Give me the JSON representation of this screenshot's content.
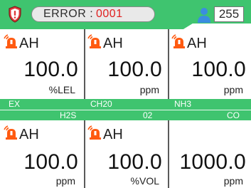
{
  "header": {
    "error_label": "ERROR :",
    "error_code": "0001",
    "user_count": "255",
    "colors": {
      "bar": "#3fc46f",
      "error_code": "#e02020"
    }
  },
  "cells": [
    {
      "status": "AH",
      "value": "100.0",
      "unit": "%LEL"
    },
    {
      "status": "AH",
      "value": "100.0",
      "unit": "ppm"
    },
    {
      "status": "AH",
      "value": "100.0",
      "unit": "ppm"
    },
    {
      "status": "AH",
      "value": "100.0",
      "unit": "ppm"
    },
    {
      "status": "AH",
      "value": "100.0",
      "unit": "%VOL"
    },
    {
      "status": "",
      "value": "1000.0",
      "unit": "ppm"
    }
  ],
  "band": {
    "top": [
      "EX",
      "CH20",
      "NH3"
    ],
    "bottom": [
      "H2S",
      "02",
      "CO"
    ]
  },
  "icons": {
    "alarm": "alarm-light-icon",
    "error": "shield-alert-icon",
    "user": "user-icon"
  }
}
